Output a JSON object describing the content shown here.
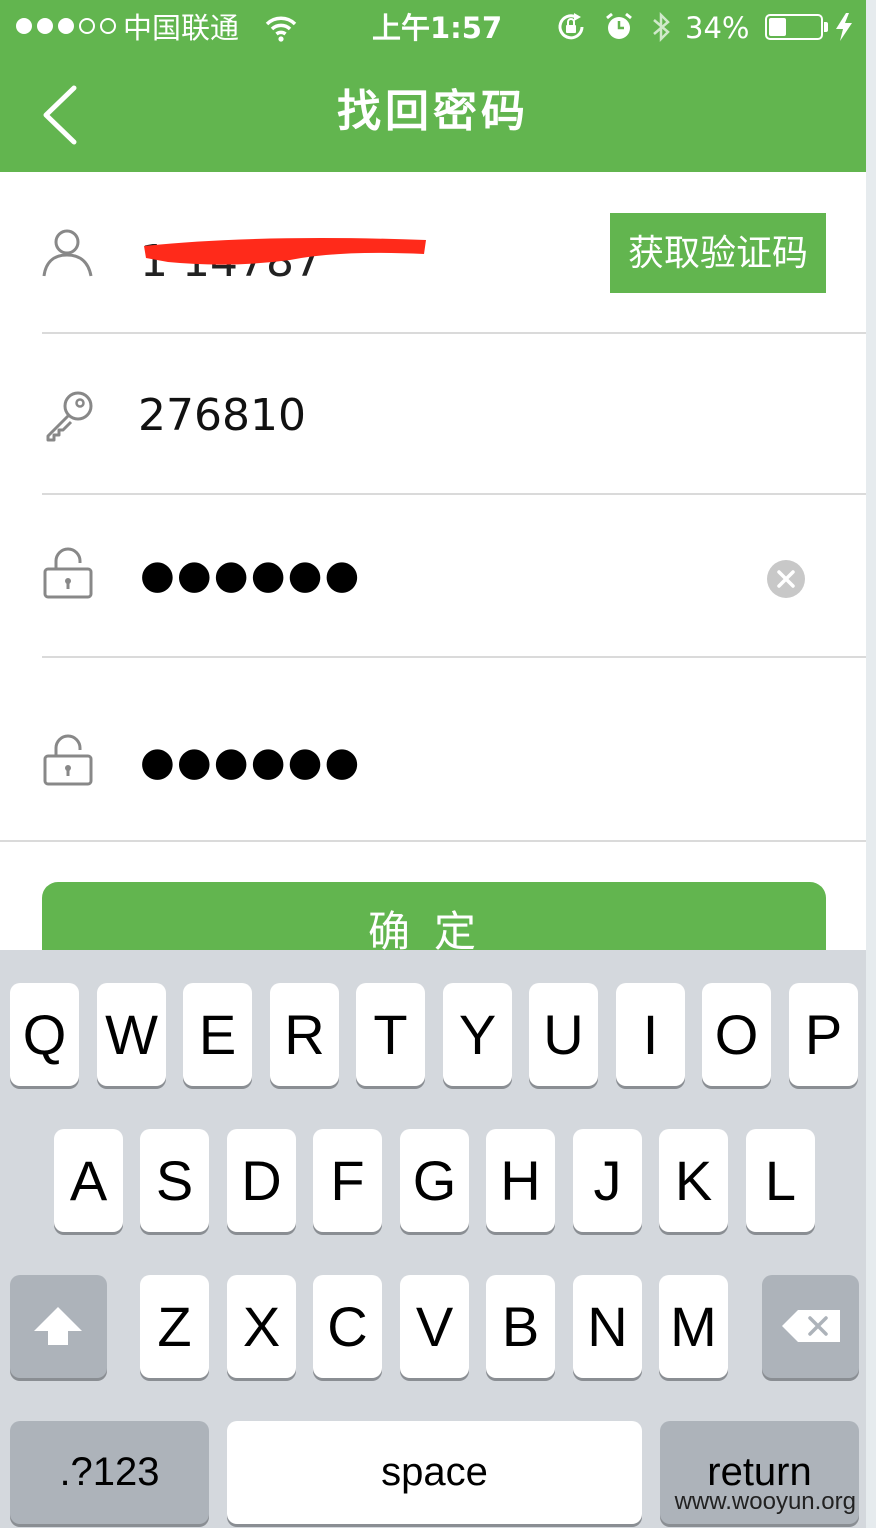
{
  "status_bar": {
    "carrier": "中国联通",
    "time": "上午1:57",
    "battery_percent": "34%",
    "battery_level": 0.34,
    "signal_strength_bars": 3,
    "icons": [
      "wifi-icon",
      "orientation-lock-icon",
      "alarm-icon",
      "bluetooth-icon",
      "battery-icon",
      "charging-bolt-icon"
    ]
  },
  "nav": {
    "title": "找回密码",
    "back_icon": "chevron-left-icon"
  },
  "form": {
    "phone": {
      "icon": "user-icon",
      "value_visible": "1   14787",
      "redacted": true
    },
    "get_code_label": "获取验证码",
    "code": {
      "icon": "key-icon",
      "value": "276810"
    },
    "new_password": {
      "icon": "unlock-icon",
      "value_masked": "●●●●●●",
      "clear_icon": "clear-circle-icon"
    },
    "confirm_password": {
      "icon": "unlock-icon",
      "value_masked": "●●●●●●"
    },
    "confirm_label": "确定"
  },
  "keyboard": {
    "row1": [
      "Q",
      "W",
      "E",
      "R",
      "T",
      "Y",
      "U",
      "I",
      "O",
      "P"
    ],
    "row2": [
      "A",
      "S",
      "D",
      "F",
      "G",
      "H",
      "J",
      "K",
      "L"
    ],
    "row3": [
      "Z",
      "X",
      "C",
      "V",
      "B",
      "N",
      "M"
    ],
    "numbers_label": ".?123",
    "space_label": "space",
    "return_label": "return",
    "shift_icon": "shift-arrow-icon",
    "delete_icon": "backspace-icon"
  },
  "watermark": "www.wooyun.org",
  "colors": {
    "brand_green": "#62b54f",
    "redaction_red": "#ff2a1a",
    "keyboard_bg": "#d4d8dd"
  }
}
